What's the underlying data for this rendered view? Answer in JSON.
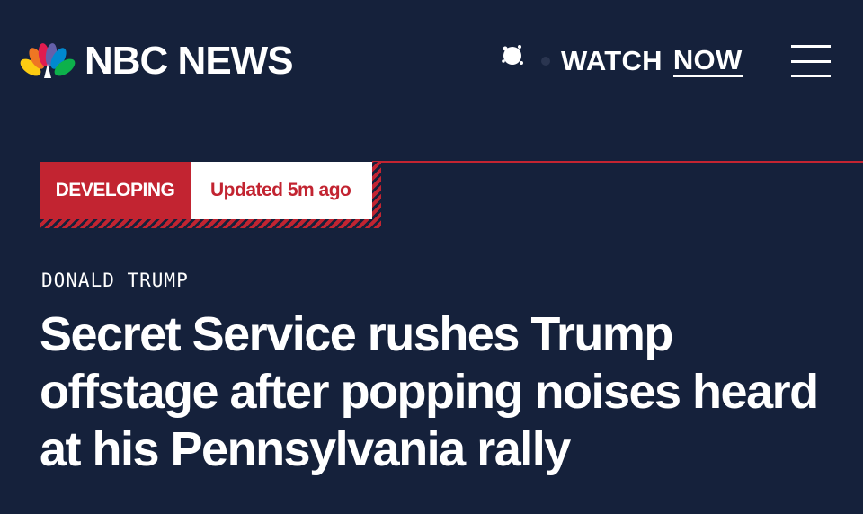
{
  "header": {
    "brand": "NBC NEWS",
    "watch_label": "WATCH",
    "now_label": "NOW"
  },
  "badge": {
    "status": "DEVELOPING",
    "updated": "Updated 5m ago"
  },
  "article": {
    "category": "DONALD TRUMP",
    "headline": "Secret Service rushes Trump offstage after popping noises heard at his Pennsylvania rally"
  },
  "colors": {
    "background": "#15213b",
    "accent_red": "#c22431",
    "text": "#ffffff"
  },
  "icons": [
    "nbc-peacock-icon",
    "live-indicator-icon",
    "hamburger-menu-icon"
  ]
}
